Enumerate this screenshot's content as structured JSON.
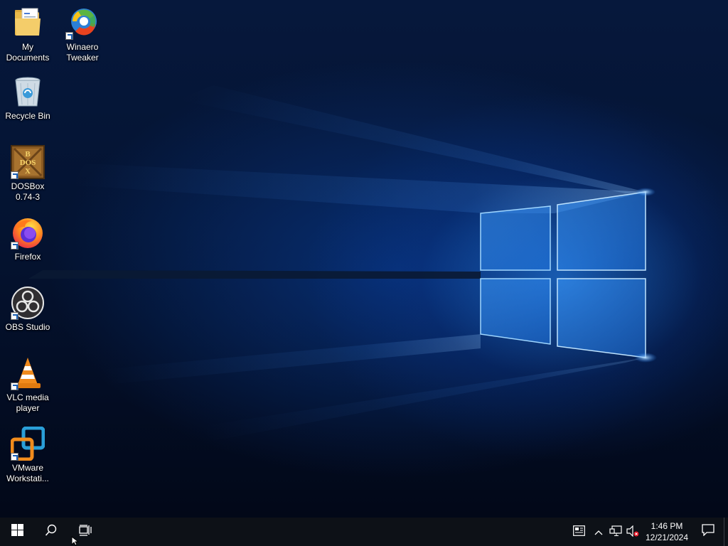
{
  "desktop": {
    "icons": [
      {
        "label": "My\nDocuments",
        "icon": "folder-documents-icon",
        "shortcut": false
      },
      {
        "label": "Winaero\nTweaker",
        "icon": "winaero-tweaker-icon",
        "shortcut": true
      },
      {
        "label": "Recycle Bin",
        "icon": "recycle-bin-icon",
        "shortcut": false
      },
      {
        "label": "DOSBox\n0.74-3",
        "icon": "dosbox-icon",
        "shortcut": true
      },
      {
        "label": "Firefox",
        "icon": "firefox-icon",
        "shortcut": true
      },
      {
        "label": "OBS Studio",
        "icon": "obs-studio-icon",
        "shortcut": true
      },
      {
        "label": "VLC media\nplayer",
        "icon": "vlc-icon",
        "shortcut": true
      },
      {
        "label": "VMware\nWorkstati...",
        "icon": "vmware-workstation-icon",
        "shortcut": true
      }
    ],
    "dosbox_logo_text": "DOSBOX"
  },
  "taskbar": {
    "start": "windows-logo-icon",
    "search": "search-icon",
    "task_view": "task-view-icon",
    "tray": [
      "news-icon",
      "chevron-up-icon",
      "network-icon",
      "volume-muted-icon"
    ],
    "clock_time": "1:46 PM",
    "clock_date": "12/21/2024",
    "notifications": "action-center-icon"
  },
  "colors": {
    "taskbar_bg": "#0d1117",
    "wallpaper_glow": "#2b8cff",
    "label_text": "#ffffff"
  }
}
